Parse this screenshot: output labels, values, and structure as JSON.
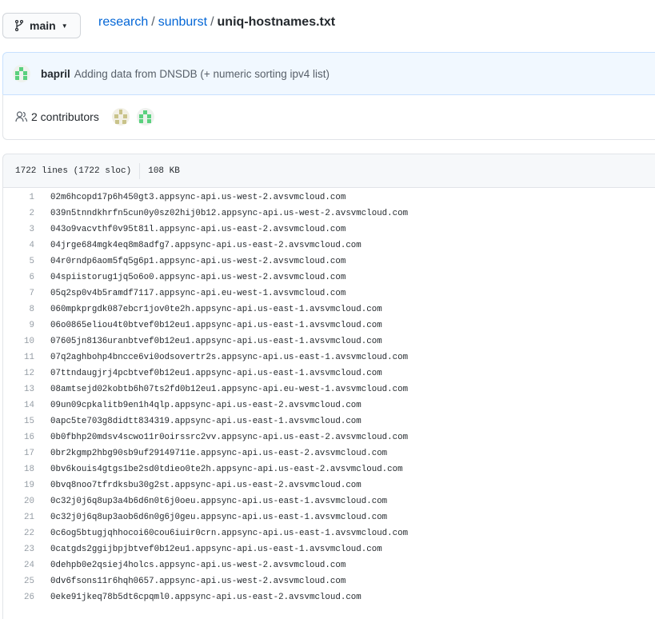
{
  "branch": {
    "label": "main"
  },
  "breadcrumb": {
    "repo": "research",
    "folder": "sunburst",
    "file": "uniq-hostnames.txt"
  },
  "commit": {
    "author": "bapril",
    "message": "Adding data from DNSDB (+ numeric sorting ipv4 list)"
  },
  "contributors": {
    "label": "2 contributors"
  },
  "file": {
    "lines": "1722 lines (1722 sloc)",
    "size": "108 KB"
  },
  "code": [
    "02m6hcopd17p6h450gt3.appsync-api.us-west-2.avsvmcloud.com",
    "039n5tnndkhrfn5cun0y0sz02hij0b12.appsync-api.us-west-2.avsvmcloud.com",
    "043o9vacvthf0v95t81l.appsync-api.us-east-2.avsvmcloud.com",
    "04jrge684mgk4eq8m8adfg7.appsync-api.us-east-2.avsvmcloud.com",
    "04r0rndp6aom5fq5g6p1.appsync-api.us-west-2.avsvmcloud.com",
    "04spiistorug1jq5o6o0.appsync-api.us-west-2.avsvmcloud.com",
    "05q2sp0v4b5ramdf7117.appsync-api.eu-west-1.avsvmcloud.com",
    "060mpkprgdk087ebcr1jov0te2h.appsync-api.us-east-1.avsvmcloud.com",
    "06o0865eliou4t0btvef0b12eu1.appsync-api.us-east-1.avsvmcloud.com",
    "07605jn8136uranbtvef0b12eu1.appsync-api.us-east-1.avsvmcloud.com",
    "07q2aghbohp4bncce6vi0odsovertr2s.appsync-api.us-east-1.avsvmcloud.com",
    "07ttndaugjrj4pcbtvef0b12eu1.appsync-api.us-east-1.avsvmcloud.com",
    "08amtsejd02kobtb6h07ts2fd0b12eu1.appsync-api.eu-west-1.avsvmcloud.com",
    "09un09cpkalitb9en1h4qlp.appsync-api.us-east-2.avsvmcloud.com",
    "0apc5te703g8didtt834319.appsync-api.us-east-1.avsvmcloud.com",
    "0b0fbhp20mdsv4scwo11r0oirssrc2vv.appsync-api.us-east-2.avsvmcloud.com",
    "0br2kgmp2hbg90sb9uf29149711e.appsync-api.us-east-2.avsvmcloud.com",
    "0bv6kouis4gtgs1be2sd0tdieo0te2h.appsync-api.us-east-2.avsvmcloud.com",
    "0bvq8noo7tfrdksbu30g2st.appsync-api.us-east-2.avsvmcloud.com",
    "0c32j0j6q8up3a4b6d6n0t6j0oeu.appsync-api.us-east-1.avsvmcloud.com",
    "0c32j0j6q8up3aob6d6n0g6j0geu.appsync-api.us-east-1.avsvmcloud.com",
    "0c6og5btugjqhhocoi60cou6iuir0crn.appsync-api.us-east-1.avsvmcloud.com",
    "0catgds2ggijbpjbtvef0b12eu1.appsync-api.us-east-1.avsvmcloud.com",
    "0dehpb0e2qsiej4holcs.appsync-api.us-west-2.avsvmcloud.com",
    "0dv6fsons11r6hqh0657.appsync-api.us-west-2.avsvmcloud.com",
    "0eke91jkeq78b5dt6cpqml0.appsync-api.us-east-2.avsvmcloud.com"
  ]
}
